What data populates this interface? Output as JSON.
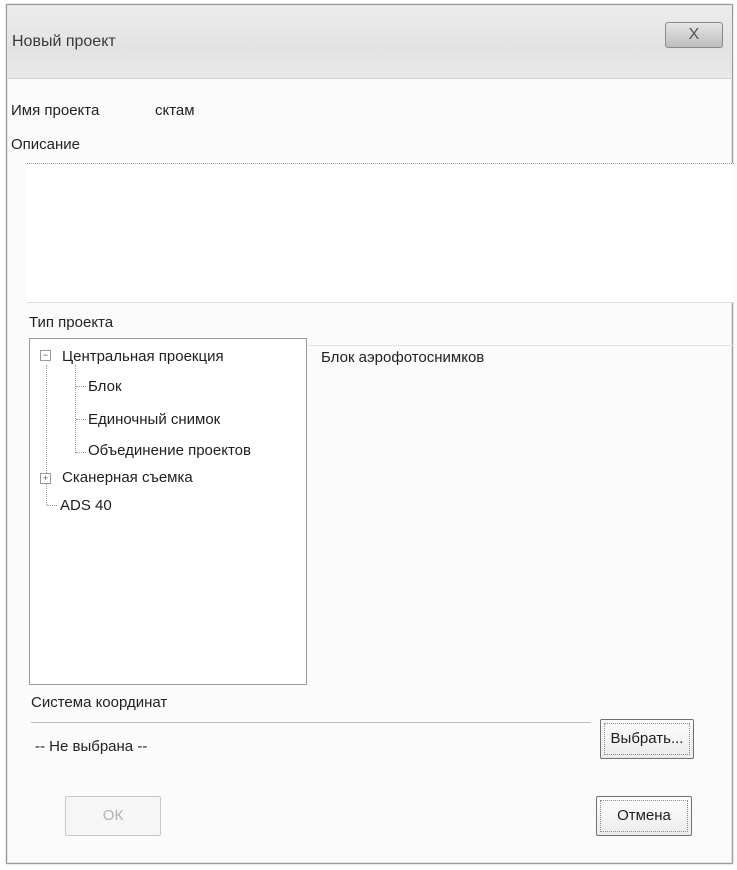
{
  "window": {
    "title": "Новый проект",
    "close_label": "X"
  },
  "project_name": {
    "label": "Имя проекта",
    "value": "сктам"
  },
  "description": {
    "label": "Описание",
    "value": ""
  },
  "project_type": {
    "label": "Тип проекта",
    "tree": {
      "central_projection": "Центральная проекция",
      "block": "Блок",
      "single_image": "Единочный снимок",
      "merge_projects": "Объединение проектов",
      "scanner_survey": "Сканерная съемка",
      "ads40": "ADS 40"
    },
    "selected_description": "Блок аэрофотоснимков"
  },
  "coordinate_system": {
    "label": "Система координат",
    "value": "-- Не выбрана --",
    "choose_button": "Выбрать..."
  },
  "buttons": {
    "ok": "ОК",
    "cancel": "Отмена"
  }
}
